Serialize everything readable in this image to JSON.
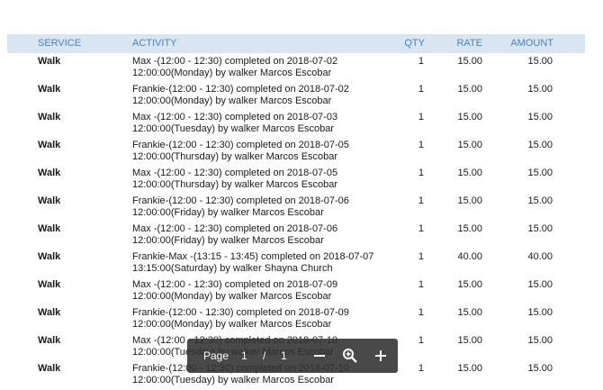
{
  "header": {
    "service": "SERVICE",
    "activity": "ACTIVITY",
    "qty": "QTY",
    "rate": "RATE",
    "amount": "AMOUNT"
  },
  "rows": [
    {
      "service": "Walk",
      "activity": "Max -(12:00 - 12:30) completed on 2018-07-02 12:00:00(Monday) by walker Marcos Escobar",
      "qty": "1",
      "rate": "15.00",
      "amount": "15.00"
    },
    {
      "service": "Walk",
      "activity": "Frankie-(12:00 - 12:30) completed on 2018-07-02 12:00:00(Monday) by walker Marcos Escobar",
      "qty": "1",
      "rate": "15.00",
      "amount": "15.00"
    },
    {
      "service": "Walk",
      "activity": "Max -(12:00 - 12:30) completed on 2018-07-03 12:00:00(Tuesday) by walker Marcos Escobar",
      "qty": "1",
      "rate": "15.00",
      "amount": "15.00"
    },
    {
      "service": "Walk",
      "activity": "Frankie-(12:00 - 12:30) completed on 2018-07-05 12:00:00(Thursday) by walker Marcos Escobar",
      "qty": "1",
      "rate": "15.00",
      "amount": "15.00"
    },
    {
      "service": "Walk",
      "activity": "Max -(12:00 - 12:30) completed on 2018-07-05 12:00:00(Thursday) by walker Marcos Escobar",
      "qty": "1",
      "rate": "15.00",
      "amount": "15.00"
    },
    {
      "service": "Walk",
      "activity": "Frankie-(12:00 - 12:30) completed on 2018-07-06 12:00:00(Friday) by walker Marcos Escobar",
      "qty": "1",
      "rate": "15.00",
      "amount": "15.00"
    },
    {
      "service": "Walk",
      "activity": "Max -(12:00 - 12:30) completed on 2018-07-06 12:00:00(Friday) by walker Marcos Escobar",
      "qty": "1",
      "rate": "15.00",
      "amount": "15.00"
    },
    {
      "service": "Walk",
      "activity": "Frankie-Max -(13:15 - 13:45) completed on 2018-07-07 13:15:00(Saturday) by walker Shayna Church",
      "qty": "1",
      "rate": "40.00",
      "amount": "40.00"
    },
    {
      "service": "Walk",
      "activity": "Max -(12:00 - 12:30) completed on 2018-07-09 12:00:00(Monday) by walker Marcos Escobar",
      "qty": "1",
      "rate": "15.00",
      "amount": "15.00"
    },
    {
      "service": "Walk",
      "activity": "Frankie-(12:00 - 12:30) completed on 2018-07-09 12:00:00(Monday) by walker Marcos Escobar",
      "qty": "1",
      "rate": "15.00",
      "amount": "15.00"
    },
    {
      "service": "Walk",
      "activity": "Max -(12:00 - 12:30) completed on 2018-07-10 12:00:00(Tuesday) by walker Marcos Escobar",
      "qty": "1",
      "rate": "15.00",
      "amount": "15.00"
    },
    {
      "service": "Walk",
      "activity": "Frankie-(12:00 - 12:30) completed on 2018-07-10 12:00:00(Tuesday) by walker Marcos Escobar",
      "qty": "1",
      "rate": "15.00",
      "amount": "15.00"
    }
  ],
  "pager": {
    "label": "Page",
    "current": "1",
    "separator": "/",
    "total": "1",
    "zoom_out_icon": "minus-icon",
    "zoom_icon": "magnifier-icon",
    "zoom_in_icon": "plus-icon"
  }
}
